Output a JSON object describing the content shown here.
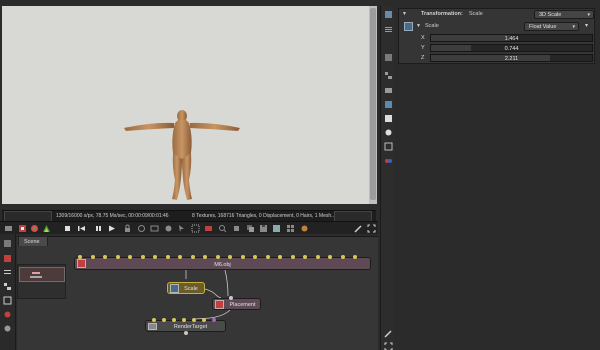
{
  "status": {
    "samples": "1309/16000 s/px, 78.75 Ms/sec, 00:00:09/00:01:46",
    "stats": "8 Textures, 168716 Triangles, 0 Displacement, 0 Hairs, 1 Mesh..."
  },
  "properties": {
    "header_title": "Transformation:",
    "header_value": "Scale",
    "mode_select": "3D Scale",
    "pin_name": "Scale",
    "value_type": "Float Value",
    "axes": [
      {
        "label": "X",
        "value": "1.464",
        "fill": 0.49
      },
      {
        "label": "Y",
        "value": "0.744",
        "fill": 0.25
      },
      {
        "label": "Z",
        "value": "2.211",
        "fill": 0.74
      }
    ]
  },
  "graph": {
    "tab_label": "Scene",
    "nodes": {
      "mesh": "M6.obj",
      "scale": "Scale",
      "placement": "Placement",
      "render_target": "RenderTarget"
    }
  },
  "colors": {
    "viewport_bg": "#d8d9d5",
    "panel_bg": "#2b2b2b",
    "graph_bg": "#363636",
    "node_mesh": "#5e4a55",
    "node_scale": "#6b5c2a",
    "pin_yellow": "#d9c75a",
    "pin_purple": "#b060c0"
  }
}
